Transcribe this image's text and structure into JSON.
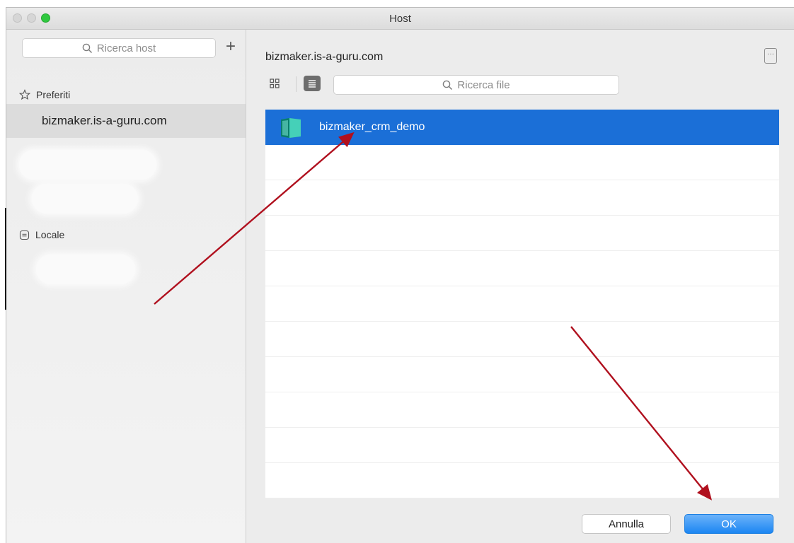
{
  "window": {
    "title": "Host"
  },
  "sidebar": {
    "search_placeholder": "Ricerca host",
    "add_label": "+",
    "favorites_label": "Preferiti",
    "favorite_host": "bizmaker.is-a-guru.com",
    "local_label": "Locale"
  },
  "main": {
    "host_path": "bizmaker.is-a-guru.com",
    "info_label": "···",
    "file_search_placeholder": "Ricerca file",
    "files": [
      {
        "name": "bizmaker_crm_demo",
        "selected": true
      }
    ],
    "cancel_label": "Annulla",
    "ok_label": "OK"
  },
  "colors": {
    "selection": "#1b6fd7",
    "ok_button": "#1c86f2",
    "arrow": "#b0101e"
  }
}
